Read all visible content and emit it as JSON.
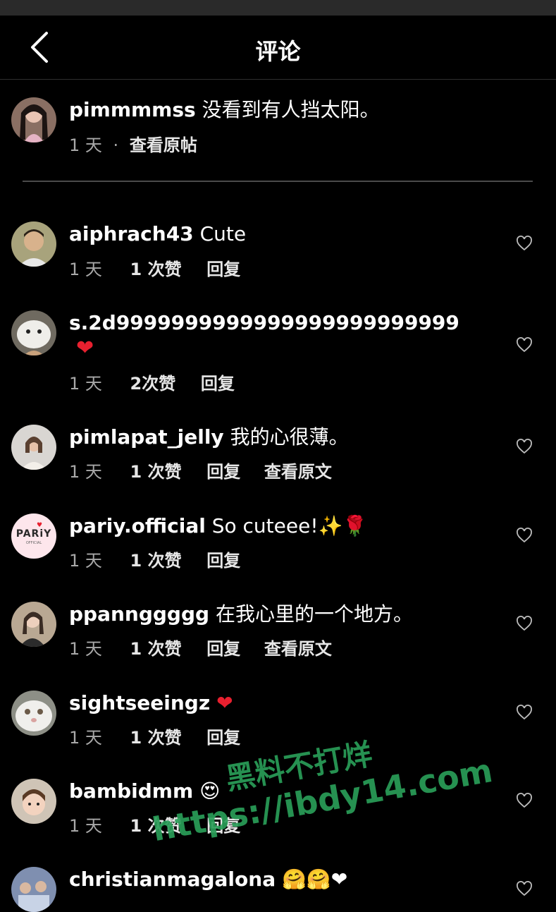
{
  "header": {
    "title": "评论"
  },
  "post": {
    "username": "pimmmmss",
    "text": "没看到有人挡太阳。",
    "time": "1 天",
    "sep": "·",
    "view_original": "查看原帖"
  },
  "comments": [
    {
      "username": "aiphrach43",
      "text": "Cute",
      "time": "1 天",
      "likes": "1 次赞",
      "reply": "回复"
    },
    {
      "username": "s.2d9999999999999999999999999",
      "text": "❤",
      "time": "1 天",
      "likes": "2次赞",
      "reply": "回复"
    },
    {
      "username": "pimlapat_jelly",
      "text": "我的心很薄。",
      "time": "1 天",
      "likes": "1 次赞",
      "reply": "回复",
      "translate": "查看原文"
    },
    {
      "username": "pariy.official",
      "text": "So cuteee!✨🌹",
      "time": "1 天",
      "likes": "1 次赞",
      "reply": "回复",
      "avatar_text": "PARiY",
      "avatar_sub": "OFFICIAL"
    },
    {
      "username": "ppannggggg",
      "text": "在我心里的一个地方。",
      "time": "1 天",
      "likes": "1 次赞",
      "reply": "回复",
      "translate": "查看原文"
    },
    {
      "username": "sightseeingz",
      "text": "❤",
      "time": "1 天",
      "likes": "1 次赞",
      "reply": "回复"
    },
    {
      "username": "bambidmm",
      "text": "😍",
      "time": "1 天",
      "likes": "1 次赞",
      "reply": "回复"
    },
    {
      "username": "christianmagalona",
      "text": "🤗🤗❤"
    }
  ],
  "watermark": {
    "line1": "黑料不打烊",
    "line2": "https://ibdy14.com"
  },
  "colors": {
    "background": "#000000",
    "meta": "#a8a8a8",
    "heart_red": "#e8202f",
    "watermark": "#2a9e58"
  }
}
